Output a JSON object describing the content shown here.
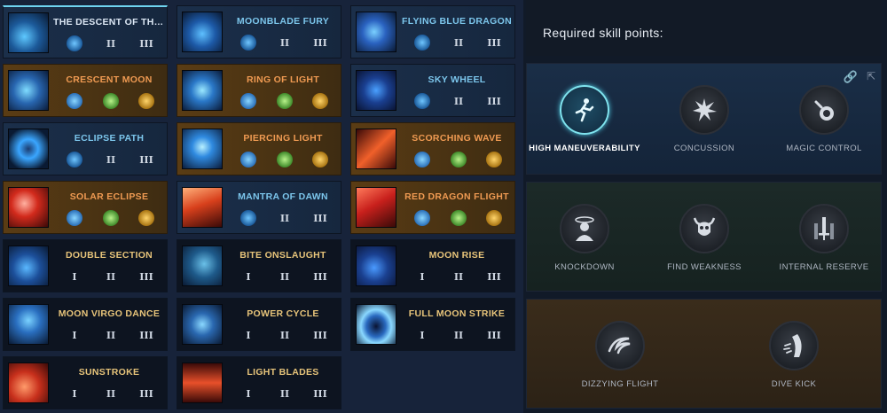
{
  "skills": [
    {
      "name": "THE DESCENT OF THE...",
      "style": "white"
    },
    {
      "name": "CRESCENT MOON",
      "style": "orange"
    },
    {
      "name": "ECLIPSE PATH",
      "style": "blue"
    },
    {
      "name": "SOLAR ECLIPSE",
      "style": "orange"
    },
    {
      "name": "DOUBLE SECTION",
      "style": "gold"
    },
    {
      "name": "MOON VIRGO DANCE",
      "style": "gold"
    },
    {
      "name": "SUNSTROKE",
      "style": "gold"
    },
    {
      "name": "MOONBLADE FURY",
      "style": "blue"
    },
    {
      "name": "RING OF LIGHT",
      "style": "orange"
    },
    {
      "name": "PIERCING LIGHT",
      "style": "orange"
    },
    {
      "name": "MANTRA OF DAWN",
      "style": "blue"
    },
    {
      "name": "BITE ONSLAUGHT",
      "style": "gold"
    },
    {
      "name": "POWER CYCLE",
      "style": "gold"
    },
    {
      "name": "LIGHT BLADES",
      "style": "gold"
    },
    {
      "name": "FLYING BLUE DRAGON",
      "style": "blue"
    },
    {
      "name": "SKY WHEEL",
      "style": "blue"
    },
    {
      "name": "SCORCHING WAVE",
      "style": "orange"
    },
    {
      "name": "RED DRAGON FLIGHT",
      "style": "orange"
    },
    {
      "name": "MOON RISE",
      "style": "gold"
    },
    {
      "name": "FULL MOON STRIKE",
      "style": "gold"
    }
  ],
  "tripod_labels": {
    "t1": "I",
    "t2": "II",
    "t3": "III"
  },
  "right_panel": {
    "title": "Required skill points:",
    "engravings_blue": [
      {
        "label": "HIGH MANEUVERABILITY",
        "icon": "running-figure-icon",
        "active": true
      },
      {
        "label": "CONCUSSION",
        "icon": "impact-icon",
        "active": false
      },
      {
        "label": "MAGIC CONTROL",
        "icon": "potion-flask-icon",
        "active": false
      }
    ],
    "engravings_green": [
      {
        "label": "KNOCKDOWN",
        "icon": "dizzy-head-icon"
      },
      {
        "label": "FIND WEAKNESS",
        "icon": "demon-skull-icon"
      },
      {
        "label": "INTERNAL RESERVE",
        "icon": "sword-icon"
      }
    ],
    "engravings_orange": [
      {
        "label": "DIZZYING FLIGHT",
        "icon": "spiral-icon"
      },
      {
        "label": "DIVE KICK",
        "icon": "kick-icon"
      }
    ]
  },
  "colors": {
    "accent_cyan": "#7fe3ee",
    "name_gold": "#e7c47a",
    "name_orange": "#ef9a52",
    "name_blue": "#7cc6ec"
  }
}
